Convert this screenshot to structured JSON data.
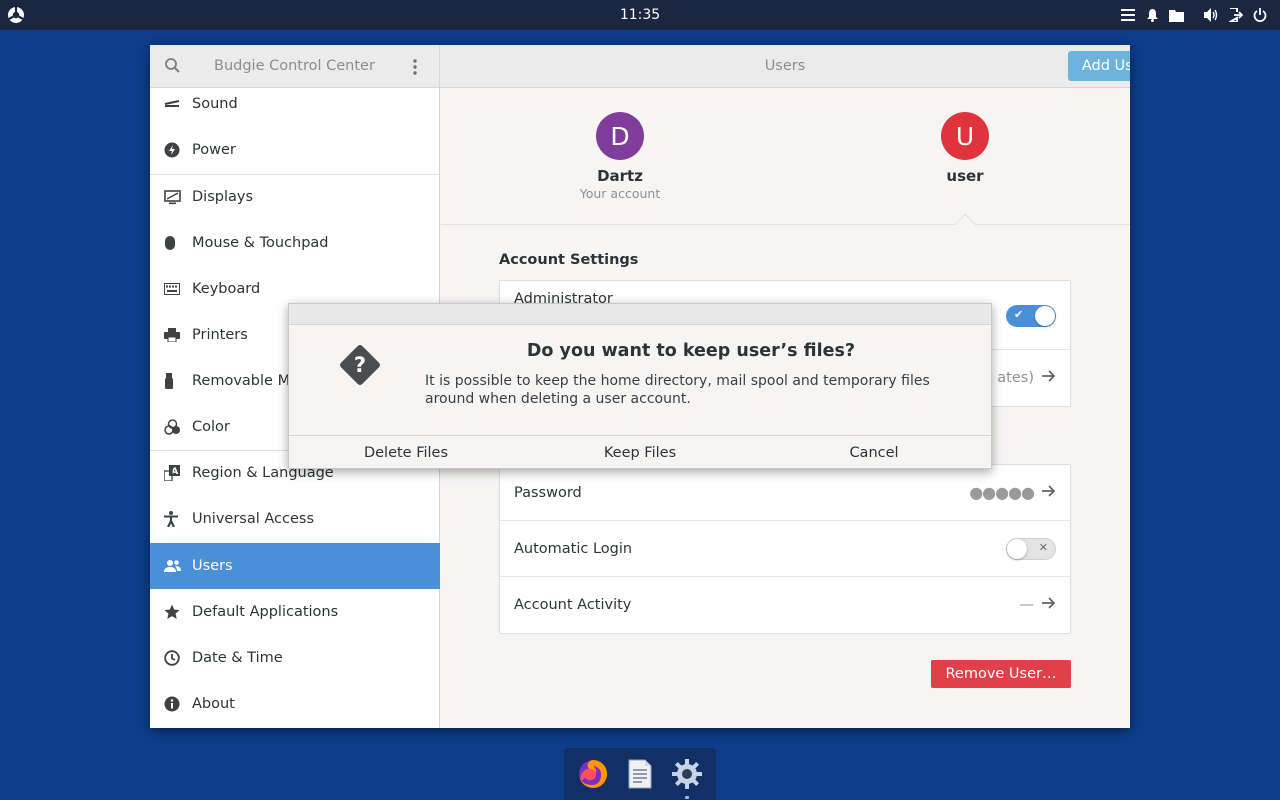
{
  "top_panel": {
    "clock": "11:35",
    "tray_icons": [
      "list-icon",
      "bell-icon",
      "folder-icon",
      "volume-icon",
      "logout-icon",
      "power-icon"
    ]
  },
  "window": {
    "sidebar_title": "Budgie Control Center",
    "page_title": "Users",
    "add_user_label": "Add User…"
  },
  "sidebar": {
    "items": [
      {
        "label": "Sound",
        "icon": "speaker-icon"
      },
      {
        "label": "Power",
        "icon": "power-bolt-icon"
      },
      {
        "label": "Displays",
        "icon": "display-icon"
      },
      {
        "label": "Mouse & Touchpad",
        "icon": "mouse-icon"
      },
      {
        "label": "Keyboard",
        "icon": "keyboard-icon"
      },
      {
        "label": "Printers",
        "icon": "printer-icon"
      },
      {
        "label": "Removable M",
        "icon": "usb-icon"
      },
      {
        "label": "Color",
        "icon": "color-icon"
      },
      {
        "label": "Region & Language",
        "icon": "language-icon"
      },
      {
        "label": "Universal Access",
        "icon": "accessibility-icon"
      },
      {
        "label": "Users",
        "icon": "users-icon"
      },
      {
        "label": "Default Applications",
        "icon": "star-icon"
      },
      {
        "label": "Date & Time",
        "icon": "clock-icon"
      },
      {
        "label": "About",
        "icon": "info-icon"
      }
    ]
  },
  "users": [
    {
      "initial": "D",
      "name": "Dartz",
      "subtitle": "Your account",
      "color": "#813d9c"
    },
    {
      "initial": "U",
      "name": "user",
      "subtitle": "",
      "color": "#e01b24"
    }
  ],
  "account_settings": {
    "title": "Account Settings",
    "administrator_label": "Administrator",
    "administrator_on": true,
    "partial_value": "ates)"
  },
  "auth": {
    "password_label": "Password",
    "password_value": "●●●●●",
    "auto_login_label": "Automatic Login",
    "auto_login_on": false,
    "activity_label": "Account Activity",
    "activity_value": "—"
  },
  "remove_user_label": "Remove User…",
  "dialog": {
    "heading": "Do you want to keep user’s files?",
    "body": "It is possible to keep the home directory, mail spool and temporary files around when deleting a user account.",
    "buttons": [
      "Delete Files",
      "Keep Files",
      "Cancel"
    ]
  },
  "dock": {
    "apps": [
      "firefox-icon",
      "text-editor-icon",
      "settings-gear-icon"
    ]
  },
  "colors": {
    "accent": "#4a90d9",
    "add_user_button": "#6cb3dd",
    "destructive": "#e0404a",
    "desktop": "#0e3d8c"
  }
}
